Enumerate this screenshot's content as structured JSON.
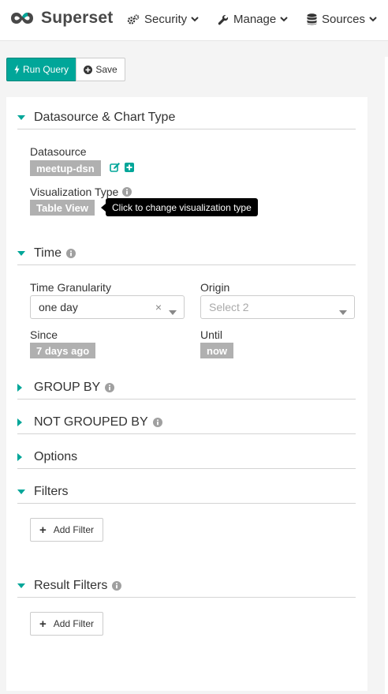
{
  "app": {
    "brand_name": "Superset",
    "accent_color": "#00a699"
  },
  "nav": {
    "items": [
      {
        "label": "Security",
        "icon": "gears-icon"
      },
      {
        "label": "Manage",
        "icon": "wrench-icon"
      },
      {
        "label": "Sources",
        "icon": "database-icon"
      }
    ]
  },
  "toolbar": {
    "run_query_label": "Run Query",
    "save_label": "Save"
  },
  "sections": {
    "datasource": {
      "title": "Datasource & Chart Type",
      "datasource_label": "Datasource",
      "datasource_value": "meetup-dsn",
      "viz_type_label": "Visualization Type",
      "viz_type_value": "Table View",
      "viz_tooltip": "Click to change visualization type"
    },
    "time": {
      "title": "Time",
      "granularity_label": "Time Granularity",
      "granularity_value": "one day",
      "origin_label": "Origin",
      "origin_placeholder": "Select 2",
      "since_label": "Since",
      "since_value": "7 days ago",
      "until_label": "Until",
      "until_value": "now"
    },
    "group_by": {
      "title": "GROUP BY"
    },
    "not_grouped_by": {
      "title": "NOT GROUPED BY"
    },
    "options": {
      "title": "Options"
    },
    "filters": {
      "title": "Filters",
      "add_label": "Add Filter"
    },
    "result_filters": {
      "title": "Result Filters",
      "add_label": "Add Filter"
    }
  }
}
